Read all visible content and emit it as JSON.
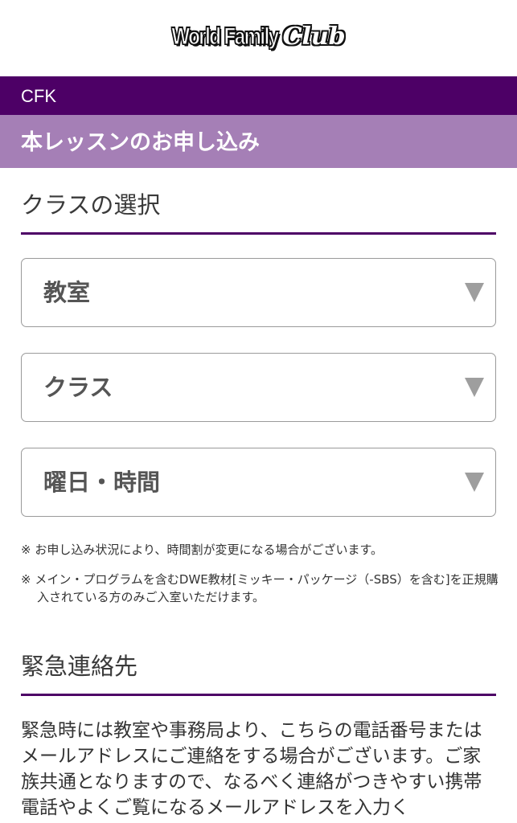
{
  "header": {
    "logo_world_text": "World Family",
    "logo_club_text": "Club"
  },
  "nav": {
    "cfk_label": "CFK",
    "page_title": "本レッスンのお申し込み"
  },
  "class_section": {
    "heading": "クラスの選択",
    "selects": [
      {
        "label": "教室"
      },
      {
        "label": "クラス"
      },
      {
        "label": "曜日・時間"
      }
    ],
    "notes": [
      "※ お申し込み状況により、時間割が変更になる場合がございます。",
      "※ メイン・プログラムを含むDWE教材[ミッキー・パッケージ（-SBS）を含む]を正規購入されている方のみご入室いただけます。"
    ]
  },
  "emergency_section": {
    "heading": "緊急連絡先",
    "description": "緊急時には教室や事務局より、こちらの電話番号またはメールアドレスにご連絡をする場合がございます。ご家族共通となりますので、なるべく連絡がつきやすい携帯電話やよくご覧になるメールアドレスを入力く"
  },
  "colors": {
    "primary_purple": "#4d0066",
    "light_purple": "#a57fb6",
    "select_border": "#9a9a9a",
    "caret": "#9e9e9e"
  },
  "icons": {
    "select_caret": "chevron-down-icon"
  }
}
